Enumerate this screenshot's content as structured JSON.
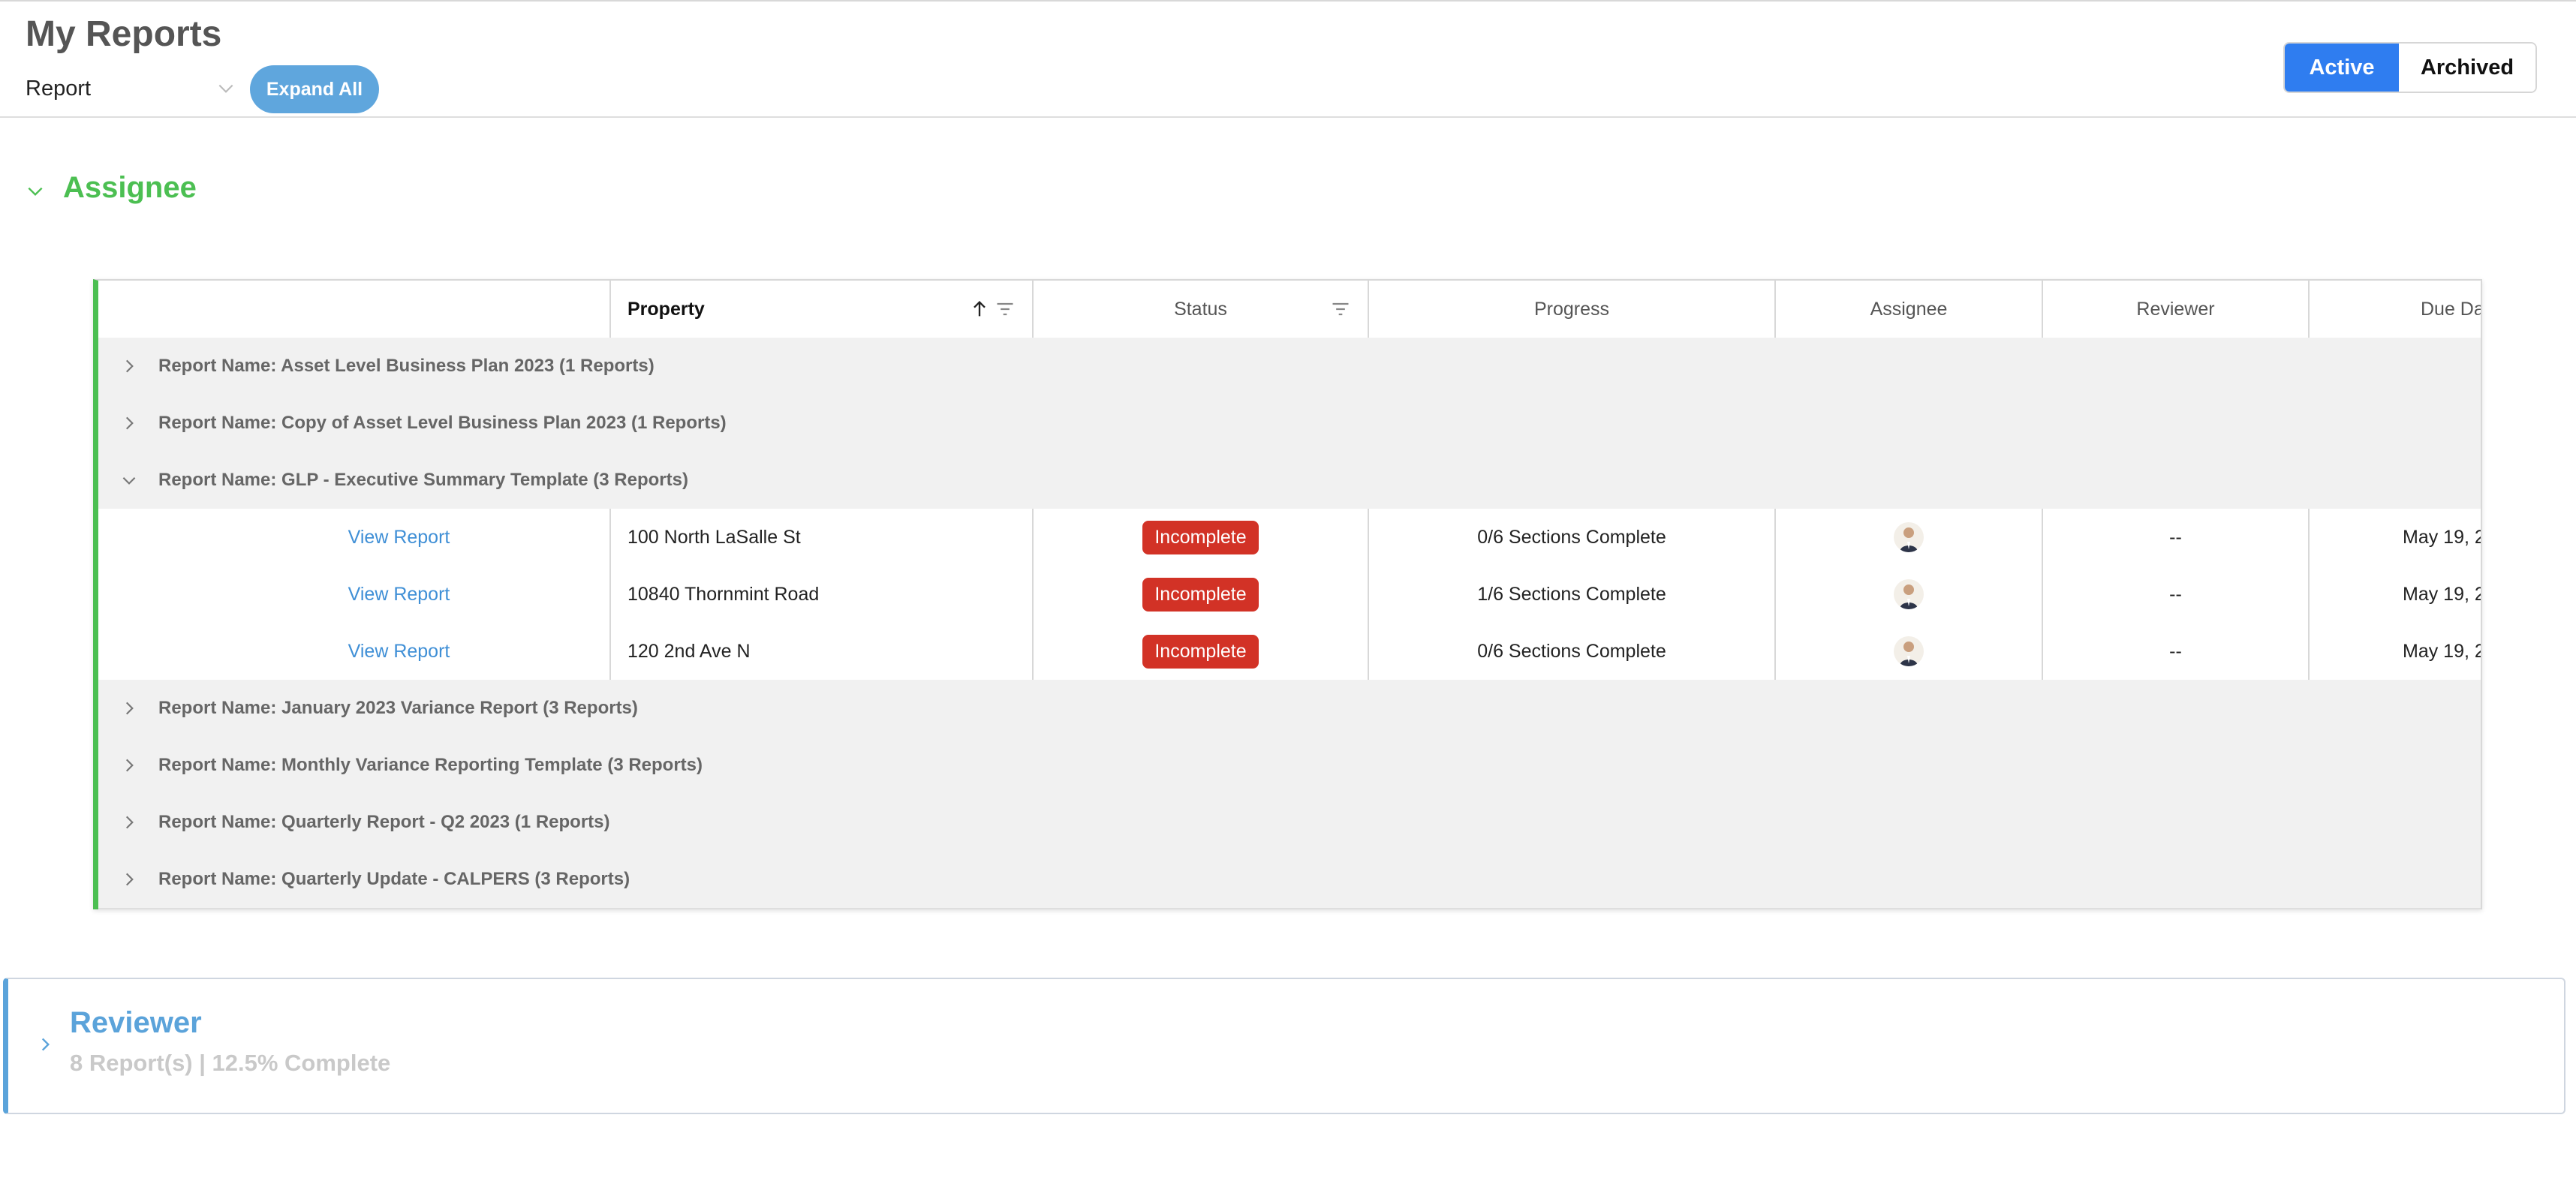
{
  "page": {
    "title": "My Reports",
    "group_by_select": "Report",
    "expand_all_label": "Expand All",
    "toggle_active": "Active",
    "toggle_archived": "Archived"
  },
  "assignee_section": {
    "title": "Assignee",
    "columns": [
      "Property",
      "Status",
      "Progress",
      "Assignee",
      "Reviewer",
      "Due Da"
    ],
    "groups": [
      {
        "label": "Report Name: Asset Level Business Plan 2023 (1 Reports)",
        "expanded": false
      },
      {
        "label": "Report Name: Copy of Asset Level Business Plan 2023 (1 Reports)",
        "expanded": false
      },
      {
        "label": "Report Name: GLP - Executive Summary Template (3 Reports)",
        "expanded": true,
        "rows": [
          {
            "action": "View Report",
            "property": "100 North LaSalle St",
            "status": "Incomplete",
            "progress": "0/6 Sections Complete",
            "reviewer": "--",
            "due": "May 19, 2"
          },
          {
            "action": "View Report",
            "property": "10840 Thornmint Road",
            "status": "Incomplete",
            "progress": "1/6 Sections Complete",
            "reviewer": "--",
            "due": "May 19, 2"
          },
          {
            "action": "View Report",
            "property": "120 2nd Ave N",
            "status": "Incomplete",
            "progress": "0/6 Sections Complete",
            "reviewer": "--",
            "due": "May 19, 2"
          }
        ]
      },
      {
        "label": "Report Name: January 2023 Variance Report (3 Reports)",
        "expanded": false
      },
      {
        "label": "Report Name: Monthly Variance Reporting Template (3 Reports)",
        "expanded": false
      },
      {
        "label": "Report Name: Quarterly Report - Q2 2023 (1 Reports)",
        "expanded": false
      },
      {
        "label": "Report Name: Quarterly Update - CALPERS (3 Reports)",
        "expanded": false
      }
    ]
  },
  "reviewer_section": {
    "title": "Reviewer",
    "summary": "8 Report(s) | 12.5% Complete"
  },
  "colors": {
    "assignee_accent": "#4cbf52",
    "reviewer_accent": "#5ba3da",
    "active_toggle": "#2f7df0",
    "expand_button": "#5fa6dd",
    "status_incomplete": "#d23226",
    "link": "#3f8fd6"
  },
  "icons": [
    "chevron-down-icon",
    "chevron-right-icon",
    "sort-ascending-icon",
    "filter-icon",
    "avatar-icon"
  ]
}
